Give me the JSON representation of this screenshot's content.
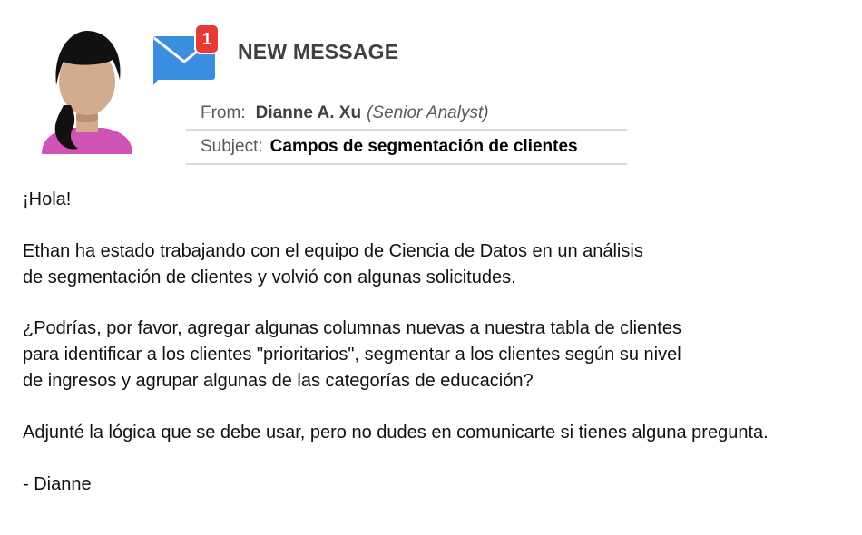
{
  "header": {
    "notification_count": "1",
    "title": "NEW MESSAGE"
  },
  "email": {
    "from_label": "From:",
    "from_name": "Dianne A. Xu",
    "from_role": "(Senior Analyst)",
    "subject_label": "Subject:",
    "subject": "Campos de segmentación de clientes"
  },
  "message": {
    "greeting": "¡Hola!",
    "paragraph1_line1": "Ethan ha estado trabajando con el equipo de Ciencia de Datos en un análisis",
    "paragraph1_line2": "de segmentación de clientes y volvió con algunas solicitudes.",
    "paragraph2_line1": "¿Podrías, por favor, agregar algunas columnas nuevas a nuestra tabla de clientes",
    "paragraph2_line2": "para identificar a los clientes \"prioritarios\", segmentar a los clientes según su nivel",
    "paragraph2_line3": "de ingresos y agrupar algunas de las categorías de educación?",
    "paragraph3": "Adjunté la lógica que se debe usar, pero no dudes en comunicarte si tienes alguna pregunta.",
    "signature": "- Dianne"
  },
  "colors": {
    "envelope_blue": "#3b8de0",
    "badge_red": "#e53935",
    "avatar_hair": "#111111",
    "avatar_skin": "#d2ac8c",
    "avatar_shirt": "#d054b6"
  }
}
